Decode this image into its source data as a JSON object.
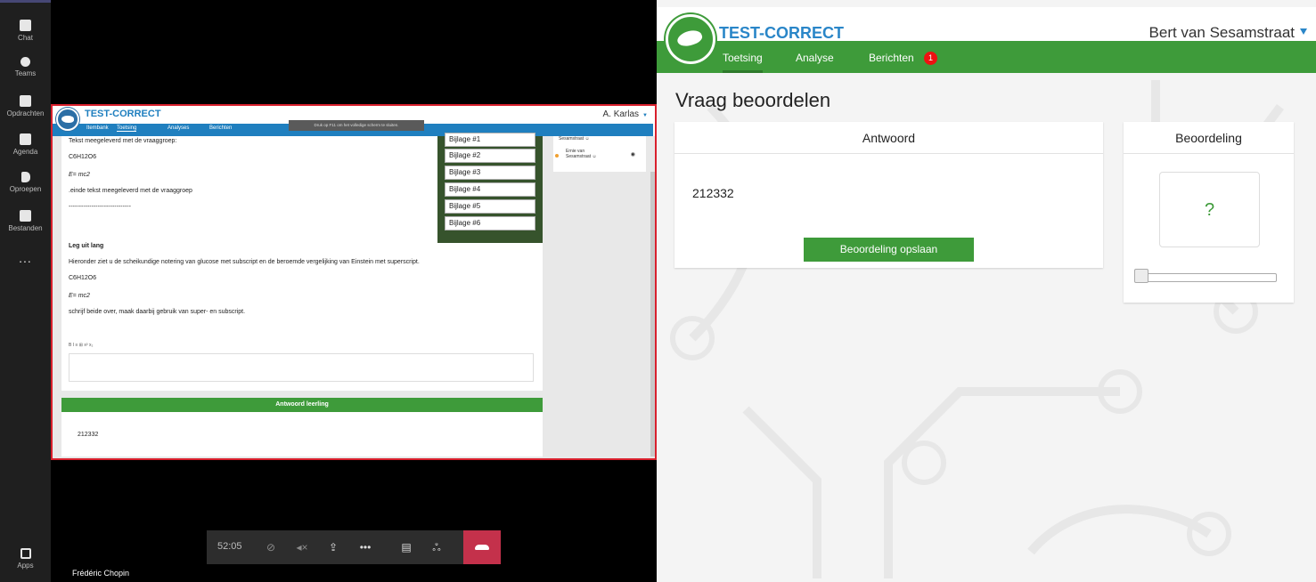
{
  "teams_rail": {
    "items": [
      {
        "label": "Chat",
        "icon": "chat-icon"
      },
      {
        "label": "Teams",
        "icon": "teams-icon"
      },
      {
        "label": "Opdrachten",
        "icon": "assignments-icon"
      },
      {
        "label": "Agenda",
        "icon": "calendar-icon"
      },
      {
        "label": "Oproepen",
        "icon": "phone-icon"
      },
      {
        "label": "Bestanden",
        "icon": "files-icon"
      },
      {
        "label": "...",
        "icon": "more-icon"
      }
    ],
    "apps_label": "Apps"
  },
  "shared_screen": {
    "brand": "TEST-CORRECT",
    "user": "A. Karlas",
    "nav": [
      "Itembank",
      "Toetsing",
      "Analyses",
      "Berichten"
    ],
    "fullscreen_hint": "Druk op  F11  om het volledige scherm te sluiten.",
    "question": {
      "context_intro": "Tekst meegeleverd met de vraaggroep:",
      "formula_1": "C6H12O6",
      "formula_2": "E= mc2",
      "context_outro": ".einde tekst meegeleverd met de vraaggroep",
      "separator": "------------------------------",
      "title": "Leg uit lang",
      "body": "Hieronder ziet u de scheikundige notering van glucose met subscript en de beroemde vergelijking van Einstein met superscript.",
      "formula_3": "C6H12O6",
      "formula_4": "E= mc2",
      "instruction": "schrijf beide over, maak daarbij gebruik van super- en subscript.",
      "toolbar": "B  I  ≡  ⊞  x²  x₂"
    },
    "attachments": [
      "Bijlage #1",
      "Bijlage #2",
      "Bijlage #3",
      "Bijlage #4",
      "Bijlage #5",
      "Bijlage #6"
    ],
    "students": [
      "Sesamstraat ☺",
      "Ernie van",
      "Sesamstraat ☺"
    ],
    "answer_header": "Antwoord leerling",
    "answer_value": "212332"
  },
  "call": {
    "time": "52:05",
    "participant": "Frédéric Chopin"
  },
  "test_correct": {
    "brand": "TEST-CORRECT",
    "user": "Bert van Sesamstraat",
    "nav": {
      "toetsing": "Toetsing",
      "analyse": "Analyse",
      "berichten": "Berichten",
      "badge": "1"
    },
    "page_title": "Vraag beoordelen",
    "answer_card": {
      "title": "Antwoord",
      "value": "212332",
      "save_label": "Beoordeling opslaan"
    },
    "grade_card": {
      "title": "Beoordeling",
      "value": "?",
      "slider_value": 0
    },
    "colors": {
      "green": "#3e9b3a",
      "blue": "#2a86c8",
      "badge": "#e11111"
    }
  }
}
